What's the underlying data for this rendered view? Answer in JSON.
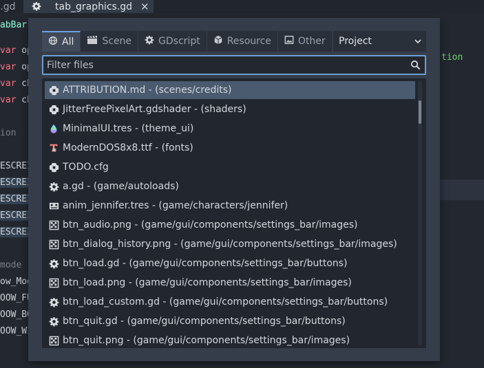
{
  "editor_tabs": [
    {
      "label": "s.gd"
    },
    {
      "label": "tab_graphics.gd",
      "close": "✕"
    }
  ],
  "code_lines": [
    {
      "text": "abBar"
    },
    {
      "kw": "var",
      "text": " op"
    },
    {
      "kw": "var",
      "text": " op"
    },
    {
      "kw": "var",
      "text": " ch"
    },
    {
      "kw": "var",
      "text": " ch"
    },
    {
      "text": "ion"
    },
    {
      "text": "ESCREI"
    },
    {
      "text": "ESCREI"
    },
    {
      "text": "ESCREI"
    },
    {
      "text": "ESCREI"
    },
    {
      "text": "ESCREI"
    },
    {
      "text": "mode"
    },
    {
      "text": "ow_Moo"
    },
    {
      "text": "OOW_FU"
    },
    {
      "text": "OOW_BO"
    },
    {
      "text": "OOW_WI"
    }
  ],
  "right_code_text": "tion",
  "dialog": {
    "tabs": [
      {
        "label": "All",
        "icon": "globe-icon"
      },
      {
        "label": "Scene",
        "icon": "scene-icon"
      },
      {
        "label": "GDscript",
        "icon": "gear-icon"
      },
      {
        "label": "Resource",
        "icon": "cube-icon"
      },
      {
        "label": "Other",
        "icon": "image-icon"
      }
    ],
    "scope_select": "Project",
    "filter_placeholder": "Filter files",
    "files": [
      {
        "label": "ATTRIBUTION.md - (scenes/credits)",
        "icon": "file-icon"
      },
      {
        "label": "JitterFreePixelArt.gdshader - (shaders)",
        "icon": "file-icon"
      },
      {
        "label": "MinimalUI.tres - (theme_ui)",
        "icon": "theme-icon"
      },
      {
        "label": "ModernDOS8x8.ttf - (fonts)",
        "icon": "font-icon"
      },
      {
        "label": "TODO.cfg",
        "icon": "file-icon"
      },
      {
        "label": "a.gd - (game/autoloads)",
        "icon": "gear-icon"
      },
      {
        "label": "anim_jennifer.tres - (game/characters/jennifer)",
        "icon": "anim-icon"
      },
      {
        "label": "btn_audio.png - (game/gui/components/settings_bar/images)",
        "icon": "image-icon"
      },
      {
        "label": "btn_dialog_history.png - (game/gui/components/settings_bar/images)",
        "icon": "image-icon"
      },
      {
        "label": "btn_load.gd - (game/gui/components/settings_bar/buttons)",
        "icon": "gear-icon"
      },
      {
        "label": "btn_load.png - (game/gui/components/settings_bar/images)",
        "icon": "image-icon"
      },
      {
        "label": "btn_load_custom.gd - (game/gui/components/settings_bar/buttons)",
        "icon": "gear-icon"
      },
      {
        "label": "btn_quit.gd - (game/gui/components/settings_bar/buttons)",
        "icon": "gear-icon"
      },
      {
        "label": "btn_quit.png - (game/gui/components/settings_bar/images)",
        "icon": "image-icon"
      }
    ],
    "selected_index": 0
  },
  "colors": {
    "accent": "#6fa2e0",
    "selection": "#4a5a6f",
    "keyword": "#ff7085",
    "dialog_bg": "#363d4a"
  }
}
